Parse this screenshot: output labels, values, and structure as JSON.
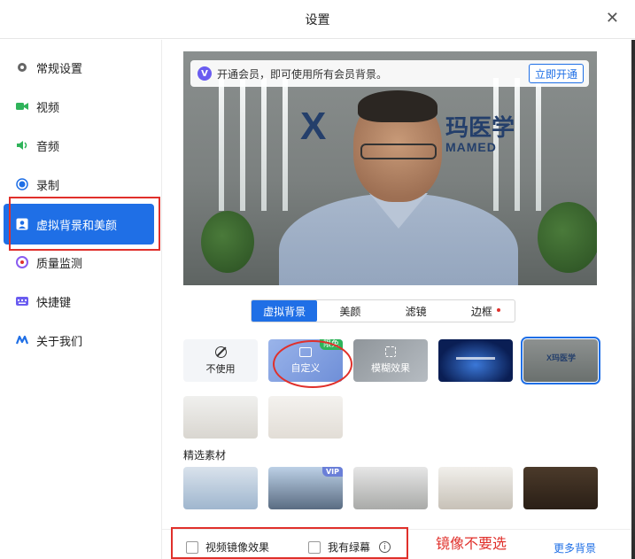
{
  "window": {
    "title": "设置",
    "close_icon": "close-icon"
  },
  "sidebar": {
    "items": [
      {
        "label": "常规设置",
        "icon": "gear-icon",
        "color": "#666666"
      },
      {
        "label": "视频",
        "icon": "video-camera-icon",
        "color": "#2fb35a"
      },
      {
        "label": "音频",
        "icon": "speaker-icon",
        "color": "#2fb35a"
      },
      {
        "label": "录制",
        "icon": "record-icon",
        "color": "#1f6fe6"
      },
      {
        "label": "虚拟背景和美颜",
        "icon": "portrait-icon",
        "active": true
      },
      {
        "label": "质量监测",
        "icon": "gauge-icon",
        "color": "#8a5cf0"
      },
      {
        "label": "快捷键",
        "icon": "keyboard-icon",
        "color": "#6a5cf0"
      },
      {
        "label": "关于我们",
        "icon": "logo-icon",
        "color": "#1f6fe6"
      }
    ]
  },
  "preview": {
    "vip_text": "开通会员，即可使用所有会员背景。",
    "vip_button": "立即开通",
    "logo_big": "X",
    "logo_cn": "玛医学",
    "logo_en": "MAMED"
  },
  "tabs": [
    {
      "label": "虚拟背景",
      "active": true
    },
    {
      "label": "美颜"
    },
    {
      "label": "滤镜"
    },
    {
      "label": "边框",
      "dot": true
    }
  ],
  "backgrounds": {
    "none_label": "不使用",
    "custom_label": "自定义",
    "custom_badge": "限免",
    "blur_label": "模糊效果",
    "office_logo": "X玛医学"
  },
  "featured": {
    "title": "精选素材",
    "vip_badge": "VIP"
  },
  "footer": {
    "mirror_label": "视频镜像效果",
    "greenscreen_label": "我有绿幕",
    "more_label": "更多背景"
  },
  "annotation": {
    "text": "镜像不要选"
  },
  "colors": {
    "accent": "#1f6fe6",
    "annotation_red": "#e0302b"
  }
}
